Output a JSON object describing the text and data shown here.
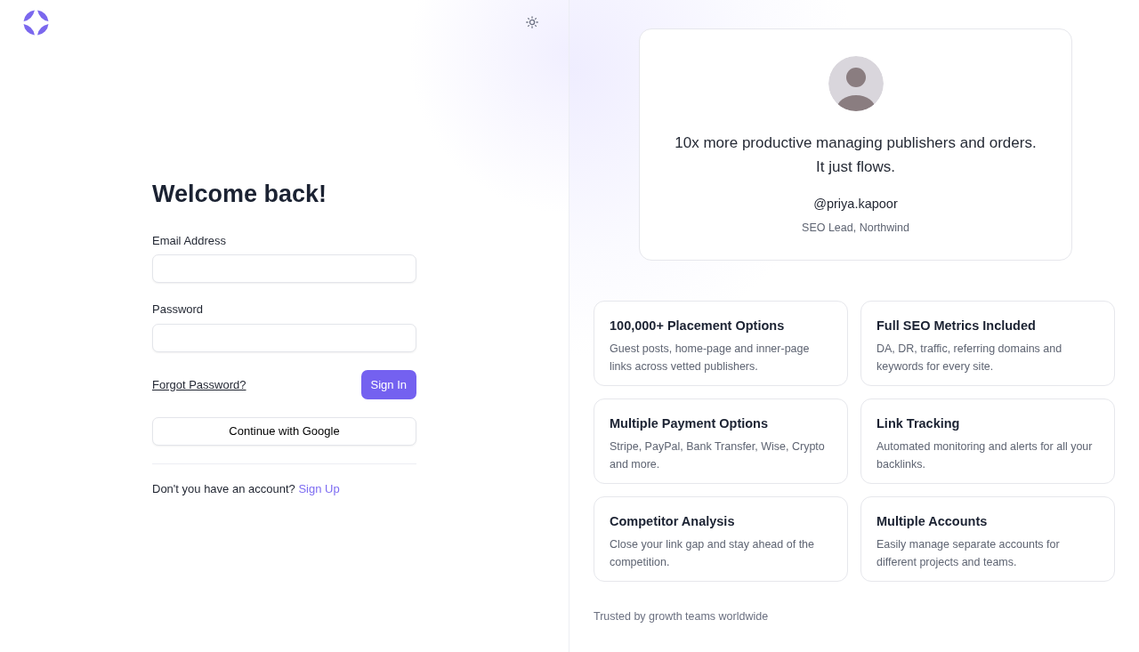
{
  "form": {
    "title": "Welcome back!",
    "email_label": "Email Address",
    "password_label": "Password",
    "forgot_link": "Forgot Password?",
    "sign_in_button": "Sign In",
    "google_button": "Continue with Google",
    "signup_prompt": "Don't you have an account?",
    "signup_link": "Sign Up"
  },
  "testimonial": {
    "quote_lines": [
      "10x more productive managing publishers and orders.",
      "It just flows."
    ],
    "handle": "@priya.kapoor",
    "role": "SEO Lead, Northwind"
  },
  "features": [
    {
      "title": "100,000+ Placement Options",
      "text": "Guest posts, home-page and inner-page links across vetted publishers."
    },
    {
      "title": "Full SEO Metrics Included",
      "text": "DA, DR, traffic, referring domains and keywords for every site."
    },
    {
      "title": "Multiple Payment Options",
      "text": "Stripe, PayPal, Bank Transfer, Wise, Crypto and more."
    },
    {
      "title": "Link Tracking",
      "text": "Automated monitoring and alerts for all your backlinks."
    },
    {
      "title": "Competitor Analysis",
      "text": "Close your link gap and stay ahead of the competition."
    },
    {
      "title": "Multiple Accounts",
      "text": "Easily manage separate accounts for different projects and teams."
    }
  ],
  "footer_note": "Trusted by growth teams worldwide"
}
